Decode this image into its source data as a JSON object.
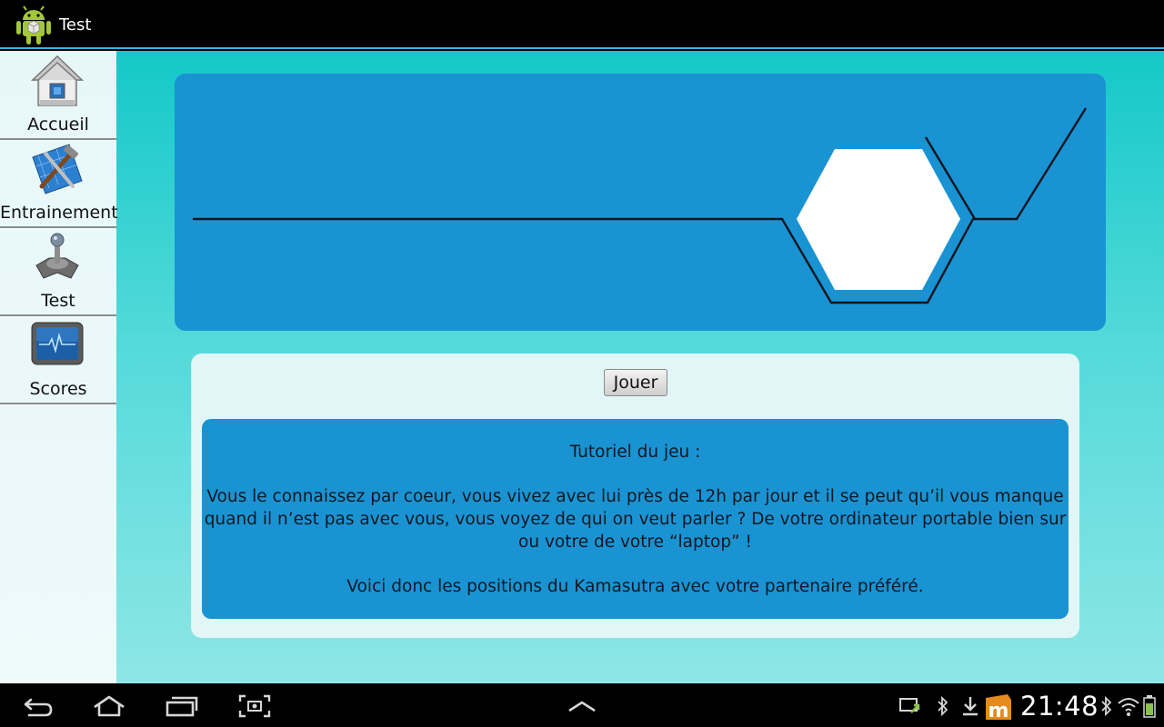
{
  "app": {
    "title": "Test"
  },
  "sidebar": {
    "items": [
      {
        "label": "Accueil",
        "icon": "home-icon"
      },
      {
        "label": "Entrainement",
        "icon": "training-tools-icon"
      },
      {
        "label": "Test",
        "icon": "joystick-icon"
      },
      {
        "label": "Scores",
        "icon": "monitor-icon"
      }
    ]
  },
  "main": {
    "play_label": "Jouer",
    "tutorial": {
      "title": "Tutoriel du jeu :",
      "body": "Vous le connaissez par coeur, vous vivez avec lui près de 12h par jour et il se peut qu’il vous manque quand il n’est pas avec vous, vous voyez de qui on veut parler ? De votre ordinateur portable bien sur ou votre de votre “laptop” !",
      "footer": "Voici donc les positions du Kamasutra avec votre partenaire préféré."
    }
  },
  "status_bar": {
    "time": "21:48"
  },
  "colors": {
    "banner": "#1a93d3",
    "content_top": "#14c8c8",
    "content_bottom": "#8ee6e6",
    "sidebar": "#e7f7f8",
    "accent": "#33b5e5"
  }
}
